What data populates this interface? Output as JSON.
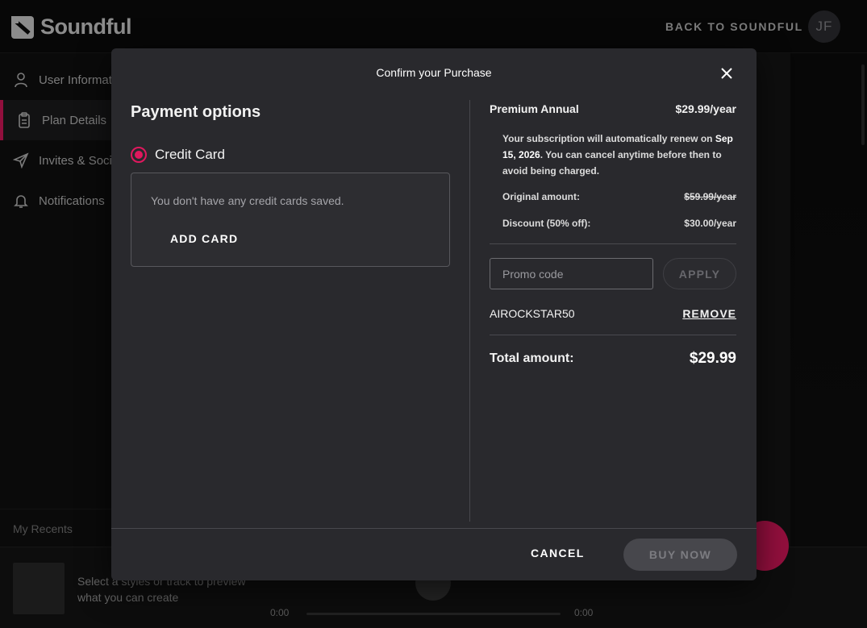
{
  "app": {
    "brand": "Soundful",
    "back_link": "BACK TO SOUNDFUL",
    "avatar_initials": "JF"
  },
  "sidebar": {
    "items": [
      {
        "label": "User Information",
        "icon": "user-icon"
      },
      {
        "label": "Plan Details",
        "icon": "clipboard-icon",
        "active": true
      },
      {
        "label": "Invites & Social",
        "icon": "send-icon"
      },
      {
        "label": "Notifications",
        "icon": "bell-icon"
      }
    ],
    "recents_label": "My Recents"
  },
  "player": {
    "message": "Select a styles or track to preview what you can create",
    "time_start": "0:00",
    "time_end": "0:00"
  },
  "modal": {
    "title": "Confirm your Purchase",
    "payment": {
      "title": "Payment options",
      "method": "Credit Card",
      "empty_message": "You don't have any credit cards saved.",
      "add_card": "ADD CARD"
    },
    "summary": {
      "plan_name": "Premium Annual",
      "plan_price": "$29.99/year",
      "renew_prefix": "Your subscription will automatically renew on ",
      "renew_date": "Sep 15, 2026",
      "renew_suffix": ". You can cancel anytime before then to avoid being charged.",
      "original_label": "Original amount:",
      "original_value": "$59.99/year",
      "discount_label": "Discount (50% off):",
      "discount_value": "$30.00/year",
      "promo_placeholder": "Promo code",
      "apply": "APPLY",
      "applied_code": "AIROCKSTAR50",
      "remove": "REMOVE",
      "total_label": "Total amount:",
      "total_value": "$29.99"
    },
    "footer": {
      "cancel": "CANCEL",
      "buy": "BUY NOW"
    }
  },
  "colors": {
    "accent": "#e0185e",
    "modal_bg": "#29292d"
  }
}
